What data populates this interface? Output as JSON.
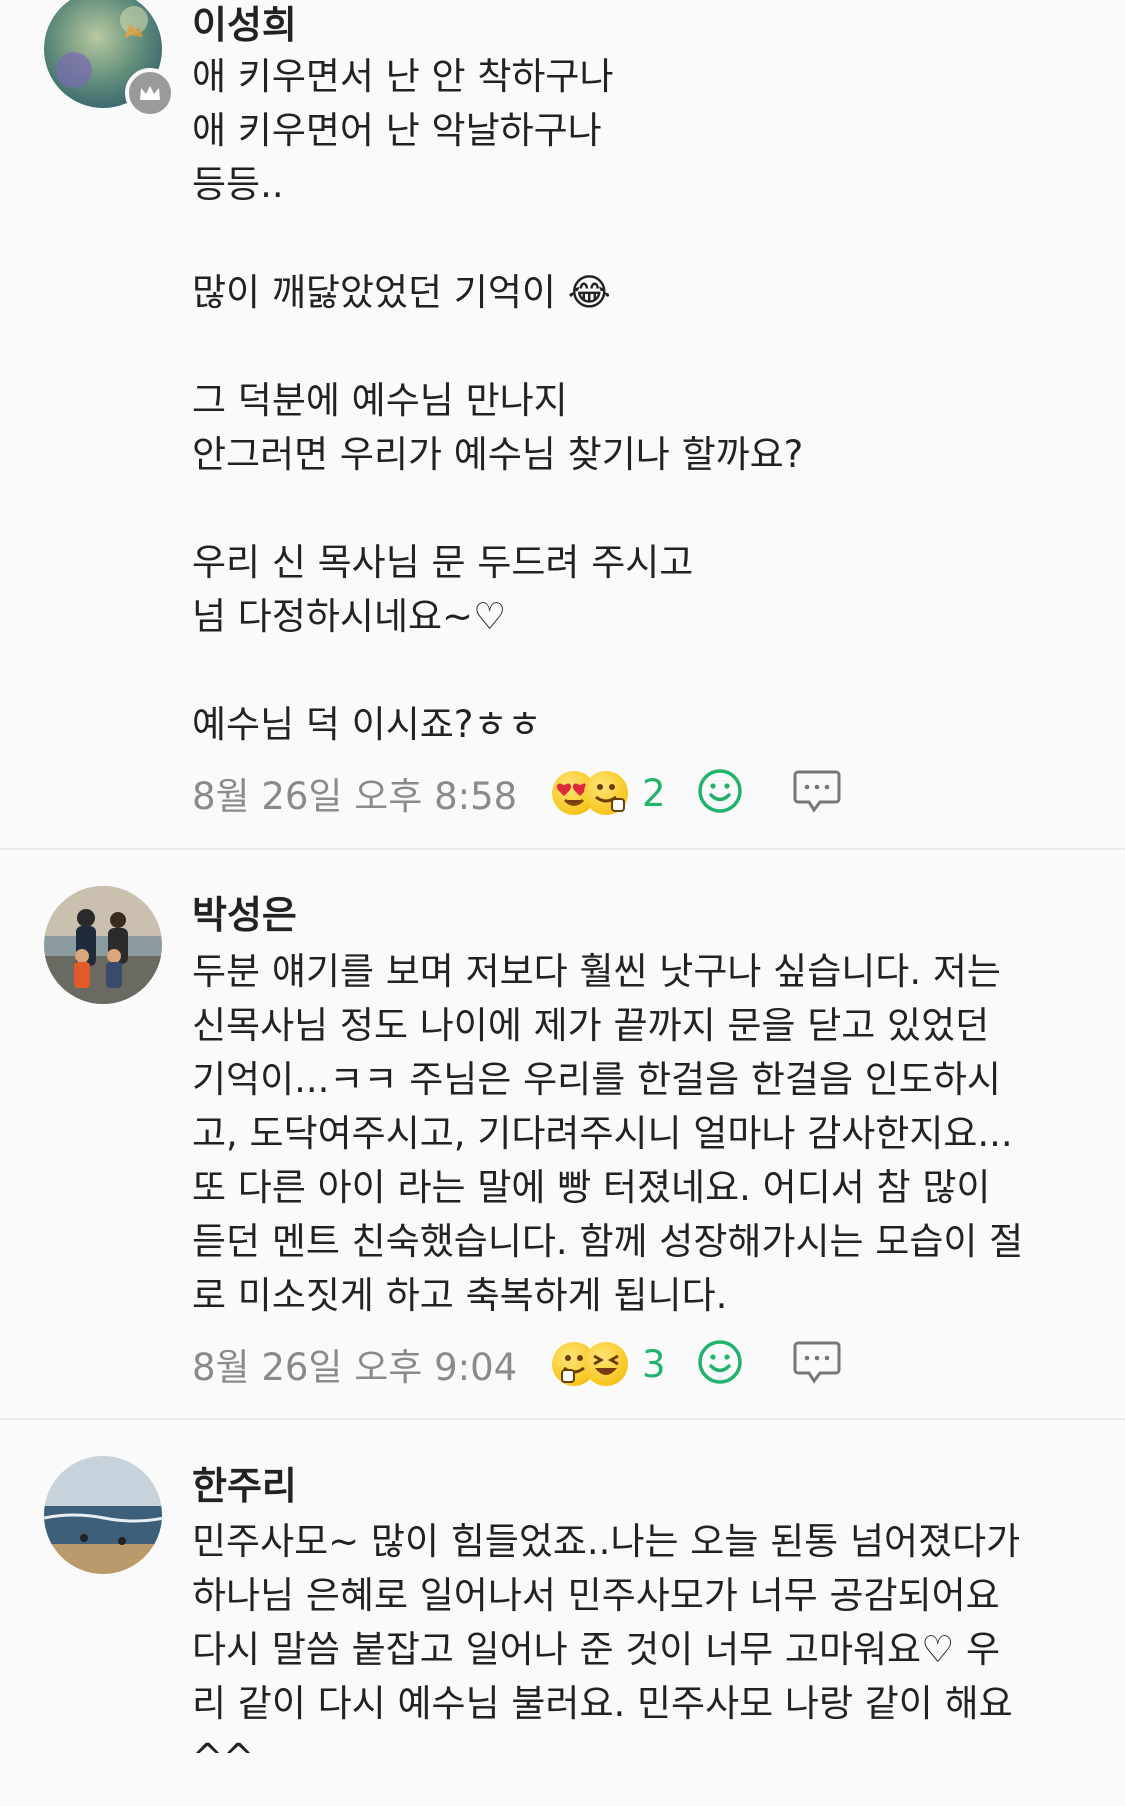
{
  "comments": [
    {
      "author": "이성희",
      "avatar": "butterfly-flower-photo",
      "badge_icon": "crown-icon",
      "lines": [
        "애 키우면서 난 안 착하구나",
        "애 키우면어 난 악날하구나",
        "등등..",
        "",
        "많이 깨닳았었던 기억이 😂",
        "",
        "그 덕분에 예수님 만나지",
        "안그러면 우리가 예수님 찾기나 할까요?",
        "",
        "우리 신 목사님 문 두드려 주시고",
        "넘 다정하시네요~♡",
        "",
        "예수님 덕 이시죠?ㅎㅎ"
      ],
      "timestamp": "8월 26일 오후 8:58",
      "reaction_icons": [
        "heart-eyes-emoji",
        "thumbs-up-emoji"
      ],
      "reaction_count": "2"
    },
    {
      "author": "박성은",
      "avatar": "family-photo",
      "lines": [
        "두분 얘기를 보며 저보다 훨씬 낫구나 싶습니다. 저는",
        "신목사님 정도 나이에 제가 끝까지 문을 닫고 있었던",
        "기억이...ㅋㅋ 주님은 우리를 한걸음 한걸음 인도하시",
        "고, 도닥여주시고, 기다려주시니 얼마나 감사한지요...",
        "또 다른 아이 라는 말에 빵 터졌네요. 어디서 참 많이",
        "듣던 멘트 친숙했습니다. 함께 성장해가시는 모습이 절",
        "로 미소짓게 하고 축복하게 됩니다."
      ],
      "timestamp": "8월 26일 오후 9:04",
      "reaction_icons": [
        "thumbs-up-emoji",
        "laughing-emoji"
      ],
      "reaction_count": "3"
    },
    {
      "author": "한주리",
      "avatar": "beach-photo",
      "lines": [
        "민주사모~ 많이 힘들었죠..나는 오늘 된통 넘어졌다가",
        "하나님 은혜로 일어나서 민주사모가 너무 공감되어요",
        "다시 말씀 붙잡고 일어나 준 것이 너무 고마워요♡ 우",
        "리 같이 다시 예수님 불러요. 민주사모 나랑 같이 해요",
        "^^"
      ]
    }
  ],
  "icons": {
    "add_reaction": "smiley-outline-icon",
    "reply": "speech-bubble-icon"
  },
  "colors": {
    "reaction_count": "#21b36b",
    "timestamp": "#8a8a8a",
    "background": "#fafafa"
  }
}
